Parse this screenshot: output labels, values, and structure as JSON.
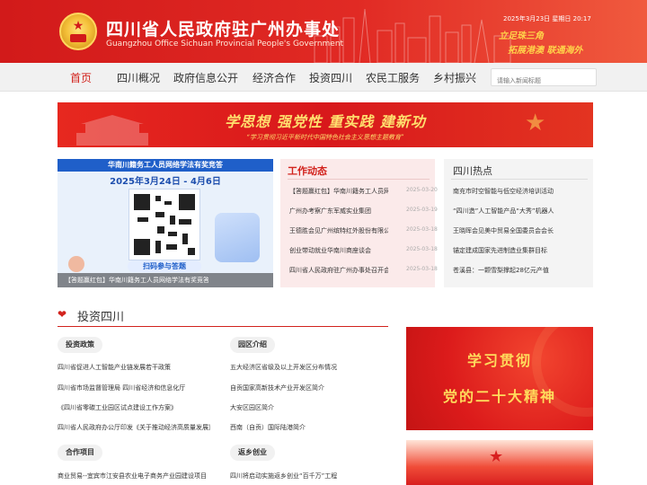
{
  "header": {
    "title_cn": "四川省人民政府驻广州办事处",
    "title_en": "Guangzhou Office Sichuan Provincial People's Government",
    "datetime": "2025年3月23日 星期日 20:17",
    "slogan_1": "立足珠三角",
    "slogan_2": "拓展港澳  联通海外"
  },
  "nav": {
    "items": [
      "首页",
      "四川概况",
      "政府信息公开",
      "经济合作",
      "投资四川",
      "农民工服务",
      "乡村振兴"
    ],
    "search_placeholder": "请输入新闻标题"
  },
  "banner": {
    "main": "学思想  强党性  重实践  建新功",
    "sub": "“学习贯彻习近平新时代中国特色社会主义思想主题教育”"
  },
  "carousel": {
    "heading": "华南川籍务工人员网络学法有奖竞答",
    "date_range": "2025年3月24日 - 4月6日",
    "scan_label": "扫码参与答题",
    "caption": "【答题赢红包】华南川籍务工人员网络学法有奖竞答",
    "dot_count": 9
  },
  "work_news": {
    "title": "工作动态",
    "items": [
      {
        "title": "【答题赢红包】华南川籍务工人员网络学法有奖竞答",
        "date": "2025-03-20"
      },
      {
        "title": "广州办考察广东军威实业集团",
        "date": "2025-03-19"
      },
      {
        "title": "王德胜会见广州缤特红外股份有限公司",
        "date": "2025-03-18"
      },
      {
        "title": "创业带动就业华南川商座谈会",
        "date": "2025-03-18"
      },
      {
        "title": "四川省人民政府驻广州办事处召开会议",
        "date": "2025-03-18"
      }
    ]
  },
  "hot": {
    "title": "四川热点",
    "items": [
      "南充市时空智能与低空经济培训活动",
      "“四川造”人工智能产品“大秀”机器人",
      "王晓晖会见美中贸易全国委员会会长",
      "锚定建成国家先进制造业集群目标",
      "苍溪县：一颗雪梨撑起28亿元产值"
    ]
  },
  "invest": {
    "section_title": "投资四川",
    "policy": {
      "label": "投资政策",
      "links": [
        "四川省促进人工智能产业链发展若干政策",
        "四川省市场监督管理局 四川省经济和信息化厅",
        "《四川省零碳工业园区试点建设工作方案》",
        "四川省人民政府办公厅印发《关于推动经济高质量发展》"
      ]
    },
    "parks": {
      "label": "园区介绍",
      "links": [
        "五大经济区省级及以上开发区分布情况",
        "自贡国家高新技术产业开发区简介",
        "大安区园区简介",
        "西南（自贡）国际陆港简介"
      ]
    },
    "projects": {
      "label": "合作项目",
      "links": [
        "商业贸易--宜宾市江安县农业电子商务产业园建设项目"
      ]
    },
    "returnees": {
      "label": "返乡创业",
      "links": [
        "四川将启动实施返乡创业“百千万”工程"
      ]
    }
  },
  "poster": {
    "line1": "学习贯彻",
    "line2": "党的二十大精神"
  },
  "colors": {
    "brand_red": "#d2231d",
    "gold": "#ffdb5c"
  }
}
